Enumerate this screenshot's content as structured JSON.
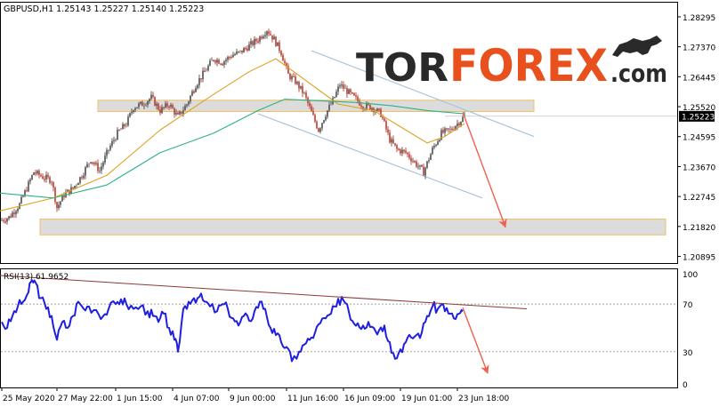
{
  "header": {
    "symbol": "GBPUSD,H1",
    "ohlc": "1.25143 1.25227 1.25140 1.25223",
    "rsi_label": "RSI(13) 61.9652"
  },
  "logo": {
    "part1": "TOR",
    "part2": "FOREX",
    "part3": ".com",
    "icon": "bull-icon"
  },
  "colors": {
    "bull_candle": "#4d4d4d",
    "bear_candle": "#c0392b",
    "ma_fast": "#e0a020",
    "ma_slow": "#2eb08a",
    "rsi": "#1f1fe0",
    "channel": "#a9c4dc",
    "trendline": "#8b3a3a",
    "zone_fill": "#d6d6d6",
    "zone_border": "#f0c060",
    "arrow": "#f06050",
    "logo_dark": "#2a2a2a",
    "logo_accent": "#e8501e"
  },
  "chart_data": [
    {
      "type": "candlestick",
      "symbol": "GBPUSD",
      "timeframe": "H1",
      "last_price": "1.25223",
      "y_ticks": [
        "1.28295",
        "1.27370",
        "1.26445",
        "1.25520",
        "1.24595",
        "1.23670",
        "1.22745",
        "1.21820",
        "1.20895"
      ],
      "ylim": [
        1.2069,
        1.2876
      ],
      "x_ticks": [
        "25 May 2020",
        "27 May 22:00",
        "1 Jun 15:00",
        "4 Jun 07:00",
        "9 Jun 00:00",
        "11 Jun 16:00",
        "16 Jun 09:00",
        "19 Jun 01:00",
        "23 Jun 18:00"
      ],
      "price_path": [
        [
          0,
          1.22
        ],
        [
          10,
          1.221
        ],
        [
          22,
          1.225
        ],
        [
          30,
          1.23
        ],
        [
          38,
          1.235
        ],
        [
          48,
          1.2335
        ],
        [
          58,
          1.2325
        ],
        [
          64,
          1.224
        ],
        [
          72,
          1.228
        ],
        [
          82,
          1.23
        ],
        [
          92,
          1.234
        ],
        [
          102,
          1.239
        ],
        [
          112,
          1.2355
        ],
        [
          122,
          1.242
        ],
        [
          132,
          1.247
        ],
        [
          142,
          1.25
        ],
        [
          150,
          1.255
        ],
        [
          160,
          1.256
        ],
        [
          170,
          1.258
        ],
        [
          180,
          1.254
        ],
        [
          190,
          1.256
        ],
        [
          200,
          1.252
        ],
        [
          210,
          1.256
        ],
        [
          220,
          1.262
        ],
        [
          230,
          1.266
        ],
        [
          240,
          1.27
        ],
        [
          250,
          1.269
        ],
        [
          260,
          1.271
        ],
        [
          270,
          1.272
        ],
        [
          280,
          1.274
        ],
        [
          290,
          1.276
        ],
        [
          300,
          1.279
        ],
        [
          308,
          1.276
        ],
        [
          316,
          1.272
        ],
        [
          324,
          1.265
        ],
        [
          332,
          1.263
        ],
        [
          342,
          1.259
        ],
        [
          352,
          1.252
        ],
        [
          358,
          1.248
        ],
        [
          366,
          1.253
        ],
        [
          374,
          1.257
        ],
        [
          382,
          1.262
        ],
        [
          390,
          1.26
        ],
        [
          398,
          1.258
        ],
        [
          408,
          1.2555
        ],
        [
          418,
          1.255
        ],
        [
          428,
          1.253
        ],
        [
          438,
          1.245
        ],
        [
          446,
          1.242
        ],
        [
          456,
          1.241
        ],
        [
          466,
          1.238
        ],
        [
          476,
          1.235
        ],
        [
          486,
          1.242
        ],
        [
          496,
          1.247
        ],
        [
          506,
          1.248
        ],
        [
          514,
          1.25
        ],
        [
          522,
          1.2522
        ]
      ],
      "ma_fast": [
        [
          0,
          1.223
        ],
        [
          60,
          1.227
        ],
        [
          120,
          1.234
        ],
        [
          180,
          1.248
        ],
        [
          240,
          1.259
        ],
        [
          280,
          1.266
        ],
        [
          310,
          1.27
        ],
        [
          340,
          1.264
        ],
        [
          380,
          1.256
        ],
        [
          420,
          1.254
        ],
        [
          450,
          1.249
        ],
        [
          480,
          1.244
        ],
        [
          500,
          1.246
        ],
        [
          522,
          1.25
        ]
      ],
      "ma_slow": [
        [
          0,
          1.2285
        ],
        [
          60,
          1.227
        ],
        [
          120,
          1.231
        ],
        [
          180,
          1.241
        ],
        [
          240,
          1.247
        ],
        [
          290,
          1.254
        ],
        [
          320,
          1.2575
        ],
        [
          360,
          1.257
        ],
        [
          400,
          1.2565
        ],
        [
          440,
          1.2555
        ],
        [
          480,
          1.254
        ],
        [
          522,
          1.253
        ]
      ],
      "channel_upper": [
        [
          350,
          1.2725
        ],
        [
          600,
          1.246
        ]
      ],
      "channel_lower": [
        [
          290,
          1.253
        ],
        [
          542,
          1.227
        ]
      ],
      "resistance_zone": {
        "x": [
          110,
          600
        ],
        "y": [
          1.2537,
          1.2572
        ]
      },
      "support_zone": {
        "x": [
          45,
          748
        ],
        "y": [
          1.2156,
          1.2205
        ]
      },
      "forecast_arrow": [
        [
          520,
          1.2535
        ],
        [
          568,
          1.218
        ]
      ]
    },
    {
      "type": "line",
      "name": "RSI(13)",
      "value": "61.9652",
      "y_ticks": [
        "100",
        "70",
        "30",
        "0"
      ],
      "ylim": [
        0,
        100
      ],
      "rsi_path": [
        [
          2,
          55
        ],
        [
          8,
          50
        ],
        [
          14,
          60
        ],
        [
          20,
          68
        ],
        [
          26,
          72
        ],
        [
          32,
          80
        ],
        [
          36,
          90
        ],
        [
          40,
          88
        ],
        [
          46,
          75
        ],
        [
          52,
          66
        ],
        [
          58,
          60
        ],
        [
          64,
          40
        ],
        [
          70,
          55
        ],
        [
          76,
          50
        ],
        [
          82,
          60
        ],
        [
          88,
          72
        ],
        [
          94,
          66
        ],
        [
          100,
          68
        ],
        [
          108,
          65
        ],
        [
          116,
          60
        ],
        [
          122,
          66
        ],
        [
          130,
          70
        ],
        [
          136,
          74
        ],
        [
          142,
          70
        ],
        [
          150,
          66
        ],
        [
          158,
          68
        ],
        [
          166,
          64
        ],
        [
          172,
          60
        ],
        [
          178,
          55
        ],
        [
          184,
          62
        ],
        [
          190,
          50
        ],
        [
          196,
          40
        ],
        [
          200,
          30
        ],
        [
          206,
          66
        ],
        [
          212,
          72
        ],
        [
          218,
          75
        ],
        [
          224,
          76
        ],
        [
          230,
          72
        ],
        [
          236,
          68
        ],
        [
          244,
          64
        ],
        [
          250,
          70
        ],
        [
          256,
          66
        ],
        [
          262,
          58
        ],
        [
          268,
          52
        ],
        [
          274,
          60
        ],
        [
          280,
          56
        ],
        [
          286,
          64
        ],
        [
          292,
          72
        ],
        [
          298,
          66
        ],
        [
          304,
          50
        ],
        [
          310,
          44
        ],
        [
          316,
          38
        ],
        [
          322,
          34
        ],
        [
          328,
          22
        ],
        [
          336,
          30
        ],
        [
          342,
          36
        ],
        [
          348,
          40
        ],
        [
          354,
          46
        ],
        [
          360,
          54
        ],
        [
          366,
          58
        ],
        [
          372,
          62
        ],
        [
          378,
          68
        ],
        [
          384,
          76
        ],
        [
          390,
          70
        ],
        [
          396,
          56
        ],
        [
          402,
          54
        ],
        [
          408,
          52
        ],
        [
          414,
          55
        ],
        [
          420,
          50
        ],
        [
          426,
          48
        ],
        [
          432,
          52
        ],
        [
          438,
          38
        ],
        [
          444,
          24
        ],
        [
          450,
          32
        ],
        [
          456,
          38
        ],
        [
          462,
          42
        ],
        [
          468,
          44
        ],
        [
          474,
          46
        ],
        [
          480,
          60
        ],
        [
          486,
          68
        ],
        [
          492,
          66
        ],
        [
          498,
          70
        ],
        [
          504,
          62
        ],
        [
          510,
          58
        ],
        [
          516,
          62
        ],
        [
          520,
          64
        ]
      ],
      "trendline": [
        [
          0,
          94
        ],
        [
          592,
          66
        ]
      ],
      "forecast_arrow": [
        [
          520,
          67
        ],
        [
          548,
          12
        ]
      ]
    }
  ]
}
